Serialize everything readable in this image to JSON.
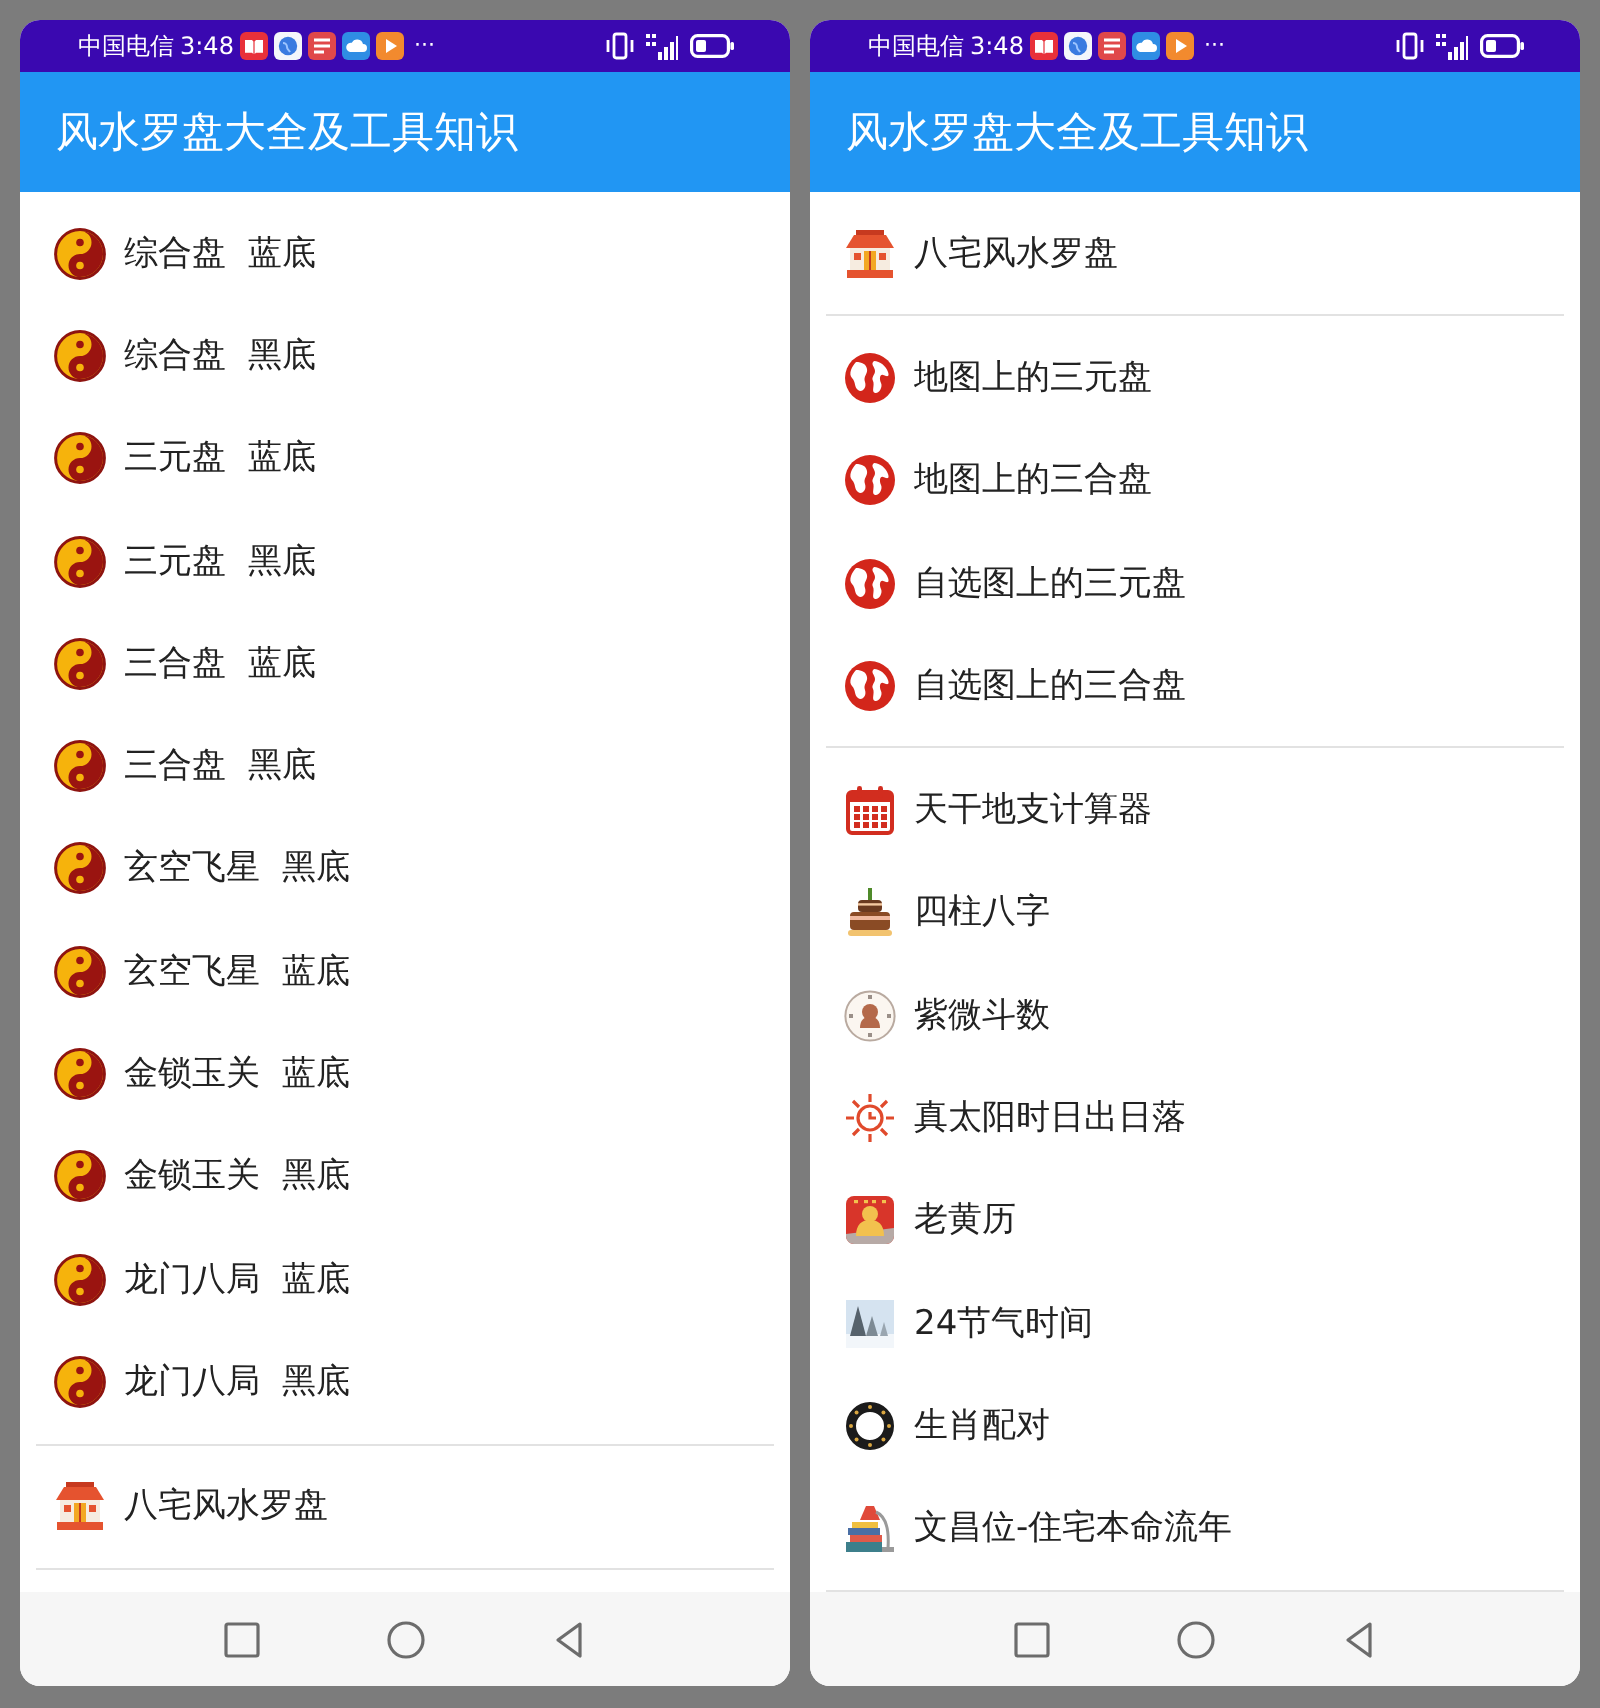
{
  "phones": [
    {
      "status_bar": {
        "carrier": "中国电信",
        "time": "3:48",
        "more": "···"
      },
      "app_bar": {
        "title": "风水罗盘大全及工具知识"
      },
      "list": {
        "sections": [
          {
            "items": [
              {
                "kind": "taiji",
                "label": "综合盘  蓝底"
              },
              {
                "kind": "taiji",
                "label": "综合盘  黑底"
              },
              {
                "kind": "taiji",
                "label": "三元盘  蓝底"
              },
              {
                "kind": "taiji",
                "label": "三元盘  黑底"
              },
              {
                "kind": "taiji",
                "label": "三合盘  蓝底"
              },
              {
                "kind": "taiji",
                "label": "三合盘  黑底"
              },
              {
                "kind": "taiji",
                "label": "玄空飞星  黑底"
              },
              {
                "kind": "taiji",
                "label": "玄空飞星  蓝底"
              },
              {
                "kind": "taiji",
                "label": "金锁玉关  蓝底"
              },
              {
                "kind": "taiji",
                "label": "金锁玉关  黑底"
              },
              {
                "kind": "taiji",
                "label": "龙门八局  蓝底"
              },
              {
                "kind": "taiji",
                "label": "龙门八局  黑底"
              }
            ]
          },
          {
            "items": [
              {
                "kind": "house",
                "label": "八宅风水罗盘"
              }
            ]
          }
        ]
      }
    },
    {
      "status_bar": {
        "carrier": "中国电信",
        "time": "3:48",
        "more": "···"
      },
      "app_bar": {
        "title": "风水罗盘大全及工具知识"
      },
      "list": {
        "sections": [
          {
            "items": [
              {
                "kind": "house",
                "label": "八宅风水罗盘"
              }
            ]
          },
          {
            "items": [
              {
                "kind": "globe",
                "label": "地图上的三元盘"
              },
              {
                "kind": "globe",
                "label": "地图上的三合盘"
              },
              {
                "kind": "globe",
                "label": "自选图上的三元盘"
              },
              {
                "kind": "globe",
                "label": "自选图上的三合盘"
              }
            ]
          },
          {
            "items": [
              {
                "kind": "calendar",
                "label": "天干地支计算器"
              },
              {
                "kind": "cake",
                "label": "四柱八字"
              },
              {
                "kind": "medallion",
                "label": "紫微斗数"
              },
              {
                "kind": "sun",
                "label": "真太阳时日出日落"
              },
              {
                "kind": "almanac",
                "label": "老黄历"
              },
              {
                "kind": "winter",
                "label": "24节气时间"
              },
              {
                "kind": "ring",
                "label": "生肖配对"
              },
              {
                "kind": "lamp",
                "label": "文昌位-住宅本命流年"
              }
            ]
          }
        ]
      }
    }
  ]
}
